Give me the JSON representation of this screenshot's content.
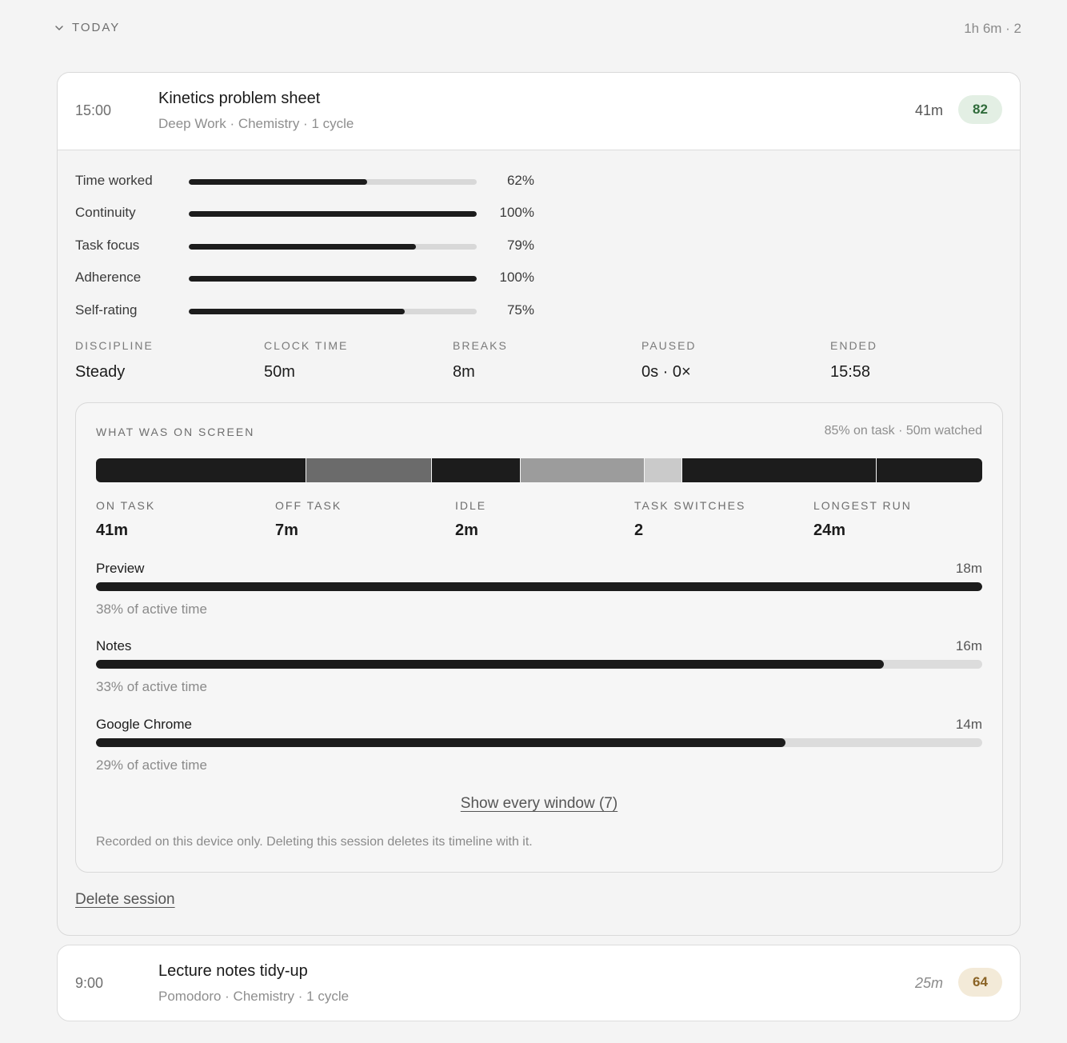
{
  "day": {
    "label": "TODAY",
    "summary": "1h 6m · 2"
  },
  "sessions": [
    {
      "time": "15:00",
      "title": "Kinetics problem sheet",
      "meta": "Deep Work · Chemistry · 1 cycle",
      "duration": "41m",
      "score": "82",
      "score_bg": "#e3efe4",
      "score_color": "#2f6b3a",
      "metrics": [
        {
          "label": "Time worked",
          "value": 0.62,
          "display": "62%"
        },
        {
          "label": "Continuity",
          "value": 1.0,
          "display": "100%"
        },
        {
          "label": "Task focus",
          "value": 0.79,
          "display": "79%"
        },
        {
          "label": "Adherence",
          "value": 1.0,
          "display": "100%"
        },
        {
          "label": "Self-rating",
          "value": 0.75,
          "display": "75%"
        }
      ],
      "stats": [
        {
          "label": "DISCIPLINE",
          "value": "Steady"
        },
        {
          "label": "CLOCK TIME",
          "value": "50m"
        },
        {
          "label": "BREAKS",
          "value": "8m"
        },
        {
          "label": "PAUSED",
          "value": "0s · 0×"
        },
        {
          "label": "ENDED",
          "value": "15:58"
        }
      ],
      "screen": {
        "title": "WHAT WAS ON SCREEN",
        "summary": "85% on task · 50m watched",
        "timeline": [
          {
            "share": 0.238,
            "color": "#1c1c1c"
          },
          {
            "share": 0.141,
            "color": "#6b6b6b"
          },
          {
            "share": 0.1,
            "color": "#1c1c1c"
          },
          {
            "share": 0.14,
            "color": "#9c9c9c"
          },
          {
            "share": 0.042,
            "color": "#cacaca"
          },
          {
            "share": 0.219,
            "color": "#1c1c1c"
          },
          {
            "share": 0.12,
            "color": "#1c1c1c"
          }
        ],
        "stats": [
          {
            "label": "ON TASK",
            "value": "41m"
          },
          {
            "label": "OFF TASK",
            "value": "7m"
          },
          {
            "label": "IDLE",
            "value": "2m"
          },
          {
            "label": "TASK SWITCHES",
            "value": "2"
          },
          {
            "label": "LONGEST RUN",
            "value": "24m"
          }
        ],
        "apps": [
          {
            "name": "Preview",
            "duration": "18m",
            "share": "38% of active time",
            "fill": 1.0
          },
          {
            "name": "Notes",
            "duration": "16m",
            "share": "33% of active time",
            "fill": 0.889
          },
          {
            "name": "Google Chrome",
            "duration": "14m",
            "share": "29% of active time",
            "fill": 0.778
          }
        ],
        "show_all": "Show every window (7)",
        "privacy": "Recorded on this device only. Deleting this session deletes its timeline with it."
      },
      "delete_label": "Delete session"
    },
    {
      "time": "9:00",
      "title": "Lecture notes tidy-up",
      "meta": "Pomodoro · Chemistry · 1 cycle",
      "duration": "25m",
      "score": "64",
      "score_bg": "#f3ead8",
      "score_color": "#8a6325"
    }
  ]
}
